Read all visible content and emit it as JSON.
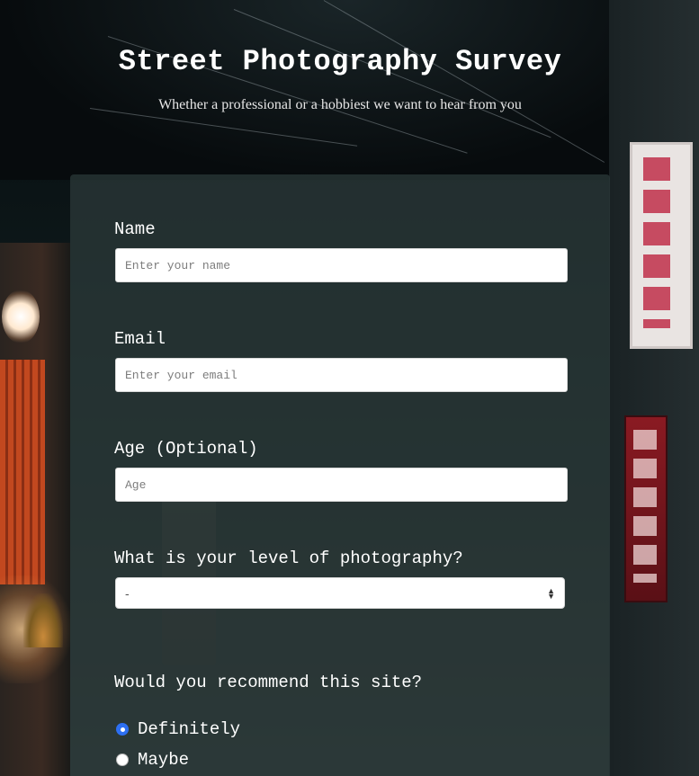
{
  "header": {
    "title": "Street Photography Survey",
    "subtitle": "Whether a professional or a hobbiest we want to hear from you"
  },
  "form": {
    "name": {
      "label": "Name",
      "placeholder": "Enter your name",
      "value": ""
    },
    "email": {
      "label": "Email",
      "placeholder": "Enter your email",
      "value": ""
    },
    "age": {
      "label": "Age (Optional)",
      "placeholder": "Age",
      "value": ""
    },
    "level": {
      "label": "What is your level of photography?",
      "selected": "-"
    },
    "recommend": {
      "label": "Would you recommend this site?",
      "options": [
        {
          "label": "Definitely",
          "checked": true
        },
        {
          "label": "Maybe",
          "checked": false
        }
      ]
    }
  },
  "colors": {
    "radio_accent": "#2d6ff2",
    "card_background": "#2c3a3a"
  },
  "icons": {
    "select_arrow": "up-down-arrows-icon"
  }
}
